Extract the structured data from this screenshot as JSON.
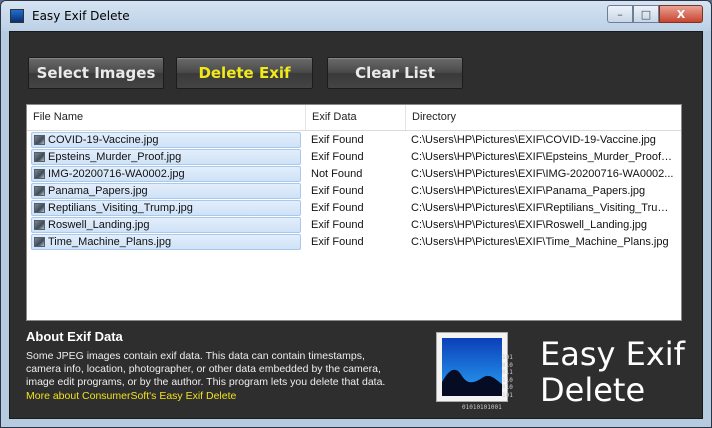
{
  "window": {
    "title": "Easy Exif Delete",
    "controls": {
      "minimize": "–",
      "maximize": "□",
      "close": "X"
    }
  },
  "toolbar": {
    "select_label": "Select Images",
    "delete_label": "Delete Exif",
    "clear_label": "Clear List",
    "delete_color": "#f2e91a"
  },
  "list": {
    "columns": [
      "File Name",
      "Exif Data",
      "Directory"
    ],
    "rows": [
      {
        "name": "COVID-19-Vaccine.jpg",
        "exif": "Exif Found",
        "dir": "C:\\Users\\HP\\Pictures\\EXIF\\COVID-19-Vaccine.jpg"
      },
      {
        "name": "Epsteins_Murder_Proof.jpg",
        "exif": "Exif Found",
        "dir": "C:\\Users\\HP\\Pictures\\EXIF\\Epsteins_Murder_Proof.jpg"
      },
      {
        "name": "IMG-20200716-WA0002.jpg",
        "exif": "Not Found",
        "dir": "C:\\Users\\HP\\Pictures\\EXIF\\IMG-20200716-WA0002..."
      },
      {
        "name": "Panama_Papers.jpg",
        "exif": "Exif Found",
        "dir": "C:\\Users\\HP\\Pictures\\EXIF\\Panama_Papers.jpg"
      },
      {
        "name": "Reptilians_Visiting_Trump.jpg",
        "exif": "Exif Found",
        "dir": "C:\\Users\\HP\\Pictures\\EXIF\\Reptilians_Visiting_Trum..."
      },
      {
        "name": "Roswell_Landing.jpg",
        "exif": "Exif Found",
        "dir": "C:\\Users\\HP\\Pictures\\EXIF\\Roswell_Landing.jpg"
      },
      {
        "name": "Time_Machine_Plans.jpg",
        "exif": "Exif Found",
        "dir": "C:\\Users\\HP\\Pictures\\EXIF\\Time_Machine_Plans.jpg"
      }
    ]
  },
  "about": {
    "title": "About Exif Data",
    "body": "Some JPEG images contain exif data. This data can contain timestamps, camera info, location, photographer, or other data embedded by the camera, image edit programs, or by the author. This program lets you delete that data.",
    "link": "More about ConsumerSoft's Easy Exif Delete"
  },
  "brand": {
    "line1": "Easy Exif",
    "line2": "Delete",
    "binary_side": [
      "101",
      "010",
      "011",
      "110",
      "010",
      "101"
    ],
    "binary_bottom": "01010101001",
    "icon": "photo-mountain-icon"
  }
}
